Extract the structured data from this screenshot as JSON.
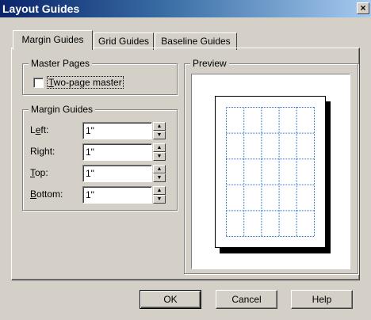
{
  "window": {
    "title": "Layout Guides",
    "close_glyph": "×"
  },
  "tabs": [
    {
      "label": "Margin Guides",
      "active": true
    },
    {
      "label": "Grid Guides",
      "active": false
    },
    {
      "label": "Baseline Guides",
      "active": false
    }
  ],
  "master_pages": {
    "group_label": "Master Pages",
    "checkbox_label_mnemonic": "T",
    "checkbox_label_rest": "wo-page master",
    "checked": false
  },
  "margin_guides": {
    "group_label": "Margin Guides",
    "fields": [
      {
        "label_pre": "L",
        "label_mnemonic": "e",
        "label_post": "ft:",
        "value": "1\""
      },
      {
        "label_pre": "Ri",
        "label_mnemonic": "g",
        "label_post": "ht:",
        "value": "1\""
      },
      {
        "label_pre": "",
        "label_mnemonic": "T",
        "label_post": "op:",
        "value": "1\""
      },
      {
        "label_pre": "",
        "label_mnemonic": "B",
        "label_post": "ottom:",
        "value": "1\""
      }
    ]
  },
  "preview": {
    "group_label": "Preview",
    "grid_columns": 5,
    "grid_rows": 5,
    "grid_color": "#1f6fe0"
  },
  "buttons": {
    "ok": "OK",
    "cancel": "Cancel",
    "help": "Help"
  },
  "colors": {
    "dialog_bg": "#d4d0c8",
    "title_start": "#0a246a",
    "title_end": "#a6caf0"
  }
}
